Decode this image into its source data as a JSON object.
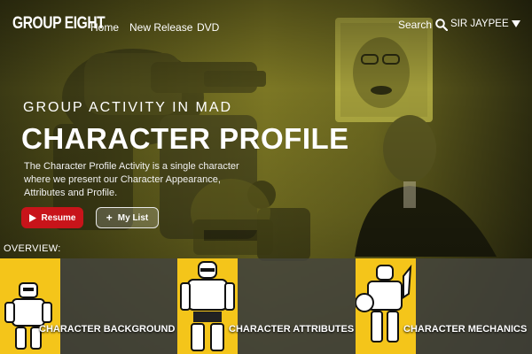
{
  "header": {
    "logo": "GROUP EIGHT",
    "nav": [
      {
        "label": "Home"
      },
      {
        "label": "New Release"
      },
      {
        "label": "DVD"
      }
    ],
    "search_label": "Search",
    "user_label": "SIR JAYPEE"
  },
  "hero": {
    "eyebrow": "GROUP ACTIVITY IN MAD",
    "title": "CHARACTER PROFILE",
    "description": "The Character Profile Activity is a single character where we present our Character Appearance, Attributes and Profile.",
    "resume_label": "Resume",
    "mylist_label": "My List"
  },
  "overview": {
    "heading": "OVERVIEW:",
    "cards": [
      {
        "label": "CHARACTER BACKGROUND"
      },
      {
        "label": "CHARACTER ATTRIBUTES"
      },
      {
        "label": "CHARACTER MECHANICS"
      }
    ]
  },
  "colors": {
    "accent_red": "#c8141a",
    "card_yellow": "#f4c51a",
    "hero_tint": "#7c7724"
  }
}
